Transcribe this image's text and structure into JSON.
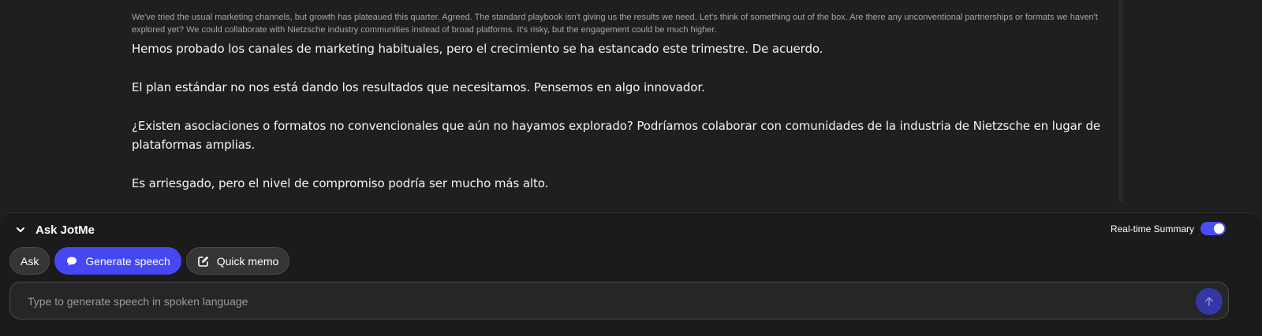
{
  "transcript": {
    "original": "We've tried the usual marketing channels, but growth has plateaued this quarter. Agreed. The standard playbook isn't giving us the results we need. Let's think of something out of the box. Are there any unconventional partnerships or formats we haven't explored yet? We could collaborate with Nietzsche industry communities instead of broad platforms. It's risky, but the engagement could be much higher.",
    "paragraphs": [
      "Hemos probado los canales de marketing habituales, pero el crecimiento se ha estancado este trimestre. De acuerdo.",
      "El plan estándar no nos está dando los resultados que necesitamos. Pensemos en algo innovador.",
      "¿Existen asociaciones o formatos no convencionales que aún no hayamos explorado? Podríamos colaborar con comunidades de la industria de Nietzsche en lugar de plataformas amplias.",
      "Es arriesgado, pero el nivel de compromiso podría ser mucho más alto."
    ]
  },
  "panel": {
    "title": "Ask JotMe",
    "collapse_icon": "chevron-down-icon",
    "realtime_summary_label": "Real-time Summary",
    "realtime_summary_enabled": true,
    "tabs": [
      {
        "label": "Ask",
        "active": false,
        "icon": ""
      },
      {
        "label": "Generate speech",
        "active": true,
        "icon": "speech-bubble-icon"
      },
      {
        "label": "Quick memo",
        "active": false,
        "icon": "edit-note-icon"
      }
    ],
    "input_placeholder": "Type to generate speech in spoken language",
    "input_value": "",
    "send_icon": "arrow-up-icon"
  },
  "colors": {
    "background": "#1f1f1f",
    "panel_background": "#1b1b1b",
    "accent": "#4548f0",
    "send_button": "#3537a6",
    "tab_background": "#353535"
  }
}
